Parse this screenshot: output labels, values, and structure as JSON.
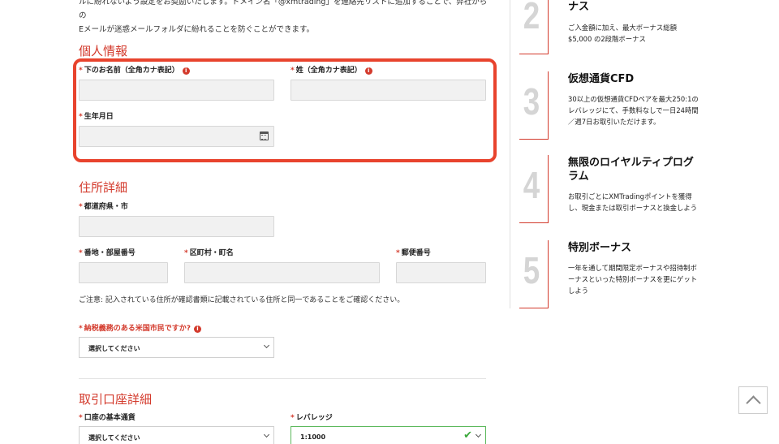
{
  "intro": {
    "line1": "ルに紛れないよう設定をお奨励いたします。ドメイン名「@xmtrading」を連絡先リストに追加することで、弊社からの",
    "line2": "Eメールが迷惑メールフォルダに紛れることを防ぐことができます。"
  },
  "personal": {
    "title": "個人情報",
    "first_name_label": "下のお名前（全角カナ表記）",
    "last_name_label": "姓（全角カナ表記）",
    "dob_label": "生年月日"
  },
  "address": {
    "title": "住所詳細",
    "prefecture_label": "都道府県・市",
    "street_label": "番地・部屋番号",
    "city_label": "区町村・町名",
    "postal_label": "郵便番号",
    "note": "ご注意: 記入されている住所が確認書類に記載されている住所と同一であることをご確認ください。"
  },
  "tax": {
    "label": "納税義務のある米国市民ですか?",
    "select_value": "選択してください"
  },
  "account": {
    "title": "取引口座詳細",
    "currency_label": "口座の基本通貨",
    "currency_value": "選択してください",
    "leverage_label": "レバレッジ",
    "leverage_value": "1:1000"
  },
  "required_mark": "*",
  "info_glyph": "i",
  "steps": [
    {
      "num": "2",
      "title": "ナス",
      "desc": "ご入金額に加え、最大ボーナス総額$5,000 の2段階ボーナス"
    },
    {
      "num": "3",
      "title": "仮想通貨CFD",
      "desc": "30以上の仮想通貨CFDペアを最大250:1のレバレッジにて、手数料なしで一日24時間／週7日お取引いただけます。"
    },
    {
      "num": "4",
      "title": "無限のロイヤルティプログラム",
      "desc": "お取引ごとにXMTradingポイントを獲得し、現金または取引ボーナスと換金しよう"
    },
    {
      "num": "5",
      "title": "特別ボーナス",
      "desc": "一年を通して期間限定ボーナスや招待制ボーナスといった特別ボーナスを更にゲットしよう"
    }
  ],
  "colors": {
    "accent": "#d33a2c",
    "highlight": "#e8432d",
    "ok": "#3aa83a"
  }
}
